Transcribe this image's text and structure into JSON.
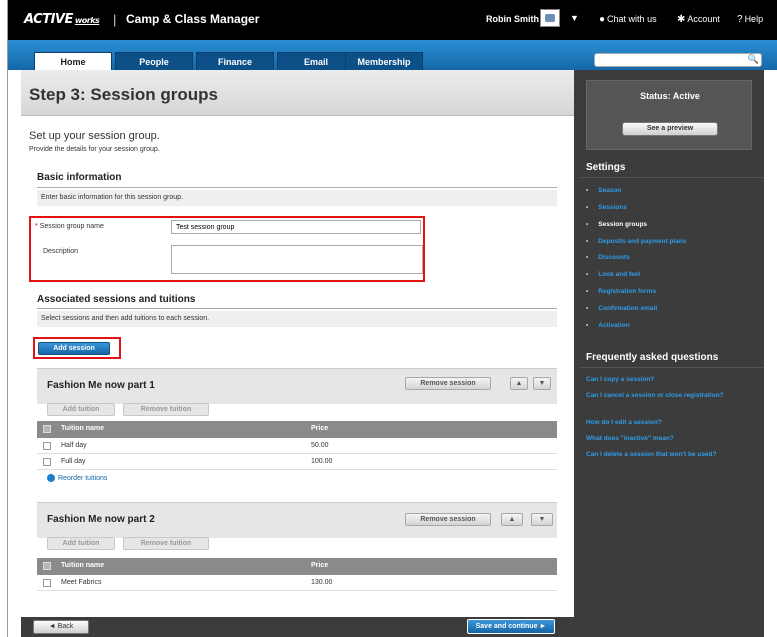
{
  "topbar": {
    "logo_main": "ACTIVE",
    "logo_sub": "works",
    "separator": "|",
    "app_title": "Camp & Class Manager",
    "user_name": "Robin Smith",
    "user_caret": "▼",
    "chat": "Chat with us",
    "account": "Account",
    "help": "Help"
  },
  "nav": {
    "tabs": [
      {
        "label": "Home"
      },
      {
        "label": "People"
      },
      {
        "label": "Finance"
      },
      {
        "label": "Email"
      },
      {
        "label": "Membership"
      }
    ],
    "search_placeholder": "",
    "search_icon": "🔍"
  },
  "page": {
    "title": "Step 3: Session groups",
    "setup_title": "Set up your session group.",
    "setup_subtitle": "Provide the details for your session group."
  },
  "basic_info": {
    "heading": "Basic information",
    "note": "Enter basic information for this session group.",
    "name_required": "*",
    "name_label": "Session group name",
    "name_value": "Test session group",
    "description_label": "Description",
    "description_value": ""
  },
  "associated": {
    "heading": "Associated sessions and tuitions",
    "note": "Select sessions and then add tuitions to each session.",
    "add_session": "Add session"
  },
  "sessions": [
    {
      "title": "Fashion Me now part 1",
      "remove_label": "Remove session",
      "up": "▲",
      "down": "▼",
      "add_tuition": "Add tuition",
      "remove_tuition": "Remove tuition",
      "col_name": "Tuition name",
      "col_price": "Price",
      "rows": [
        {
          "name": "Half day",
          "price": "50.00"
        },
        {
          "name": "Full day",
          "price": "100.00"
        }
      ],
      "reorder": "Reorder tuitions"
    },
    {
      "title": "Fashion Me now part 2",
      "remove_label": "Remove session",
      "up": "▲",
      "down": "▼",
      "add_tuition": "Add tuition",
      "remove_tuition": "Remove tuition",
      "col_name": "Tuition name",
      "col_price": "Price",
      "rows": [
        {
          "name": "Meet Fabrics",
          "price": "130.00"
        }
      ]
    }
  ],
  "sidebar": {
    "status": "Status: Active",
    "preview": "See a preview",
    "settings_heading": "Settings",
    "settings": [
      {
        "label": "Season"
      },
      {
        "label": "Sessions"
      },
      {
        "label": "Session groups"
      },
      {
        "label": "Deposits and payment plans"
      },
      {
        "label": "Discounts"
      },
      {
        "label": "Look and feel"
      },
      {
        "label": "Registration forms"
      },
      {
        "label": "Confirmation email"
      },
      {
        "label": "Activation"
      }
    ],
    "faq_heading": "Frequently asked questions",
    "faqs": [
      {
        "label": "Can I copy a session?"
      },
      {
        "label": "Can I cancel a session or close registration?"
      },
      {
        "label": "How do I edit a session?"
      },
      {
        "label": "What does \"inactive\" mean?"
      },
      {
        "label": "Can I delete a session that won't be used?"
      }
    ]
  },
  "footer": {
    "back": "◄ Back",
    "save": "Save and continue ►"
  },
  "colors": {
    "accent": "#1f7ec8",
    "highlight_box": "#e01414",
    "sidebar_bg": "#3c3c3c"
  }
}
